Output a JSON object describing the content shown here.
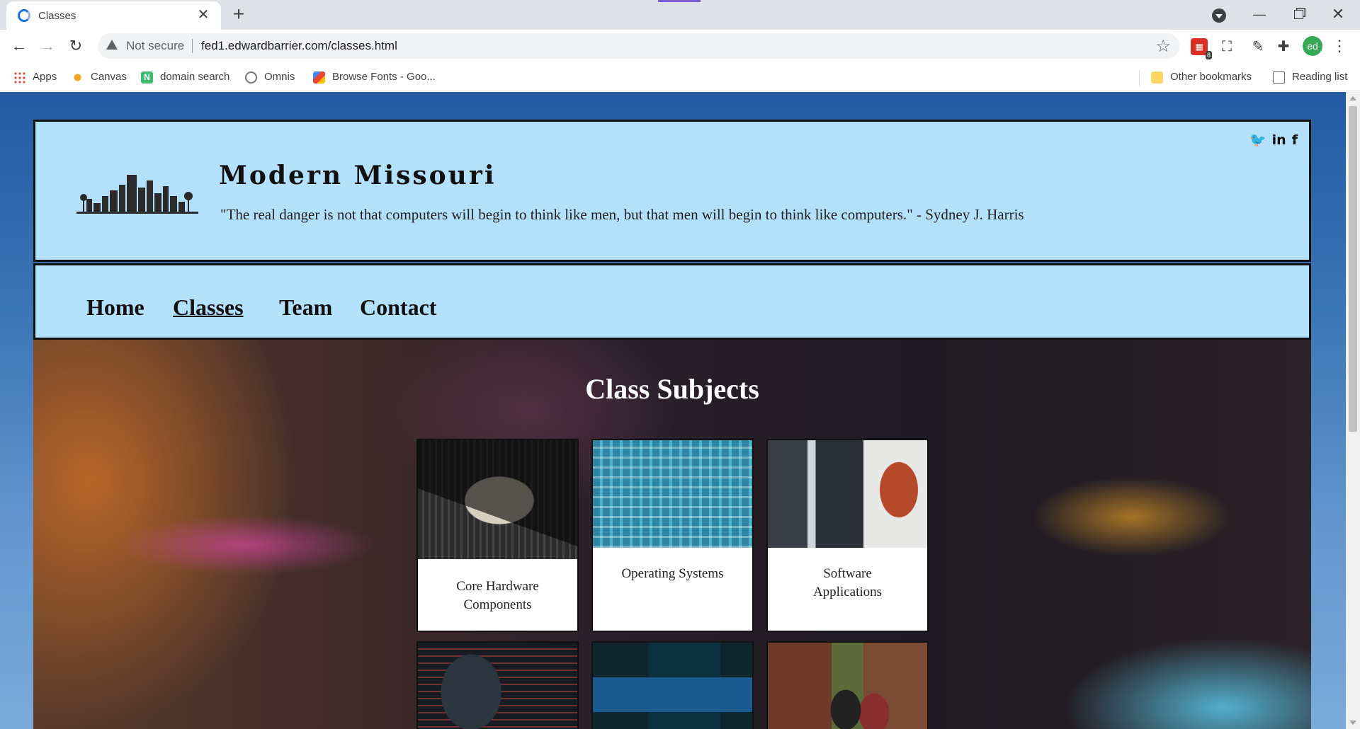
{
  "browser": {
    "tab_title": "Classes",
    "tab_close": "✕",
    "new_tab": "+",
    "not_secure": "Not secure",
    "url": "fed1.edwardbarrier.com/classes.html",
    "extension_badge": "8",
    "profile_initials": "ed",
    "bookmarks": [
      {
        "label": "Apps",
        "icon": "apps-grid-icon"
      },
      {
        "label": "Canvas",
        "icon": "canvas-icon"
      },
      {
        "label": "domain search",
        "icon": "n-letter-icon"
      },
      {
        "label": "Omnis",
        "icon": "omnis-icon"
      },
      {
        "label": "Browse Fonts - Goo...",
        "icon": "google-fonts-icon"
      }
    ],
    "other_bookmarks": "Other bookmarks",
    "reading_list": "Reading list"
  },
  "site": {
    "title": "Modern Missouri",
    "quote": "\"The real danger is not that computers will begin to think like men, but that men will begin to think like computers.\" - Sydney J. Harris",
    "social": {
      "twitter": "🐦",
      "linkedin": "in",
      "facebook": "f"
    },
    "nav": [
      {
        "label": "Home",
        "active": false
      },
      {
        "label": "Classes",
        "active": true
      },
      {
        "label": "Team",
        "active": false
      },
      {
        "label": "Contact",
        "active": false
      }
    ],
    "section_title": "Class Subjects",
    "cards": [
      {
        "label": "Core Hardware Components",
        "image": "cpu-image"
      },
      {
        "label": "Operating Systems",
        "image": "network-cables-image"
      },
      {
        "label": "Software Applications",
        "image": "office-worker-image"
      },
      {
        "label": "",
        "image": "hacker-image"
      },
      {
        "label": "",
        "image": "desktop-pc-image"
      },
      {
        "label": "",
        "image": "students-image"
      }
    ]
  }
}
